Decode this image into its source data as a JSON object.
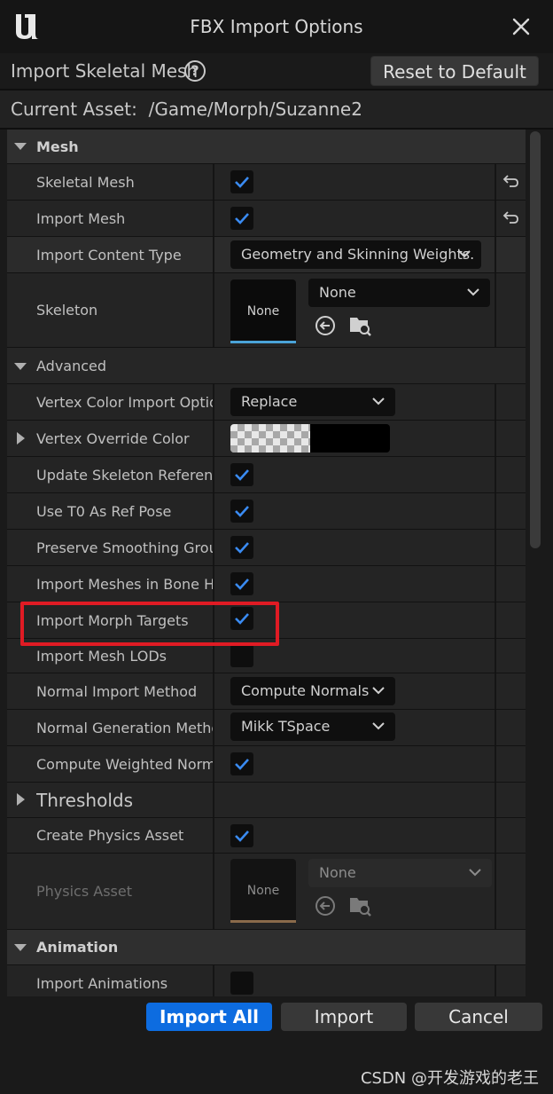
{
  "window": {
    "title": "FBX Import Options",
    "close_icon": "close-icon",
    "logo_icon": "unreal-logo-icon"
  },
  "header": {
    "label": "Import Skeletal Mesh",
    "help_icon": "?",
    "reset_label": "Reset to Default"
  },
  "asset": {
    "label": "Current Asset:  /Game/Morph/Suzanne2"
  },
  "sections": {
    "mesh": "Mesh",
    "advanced": "Advanced",
    "thresholds": "Thresholds",
    "animation": "Animation"
  },
  "rows": {
    "skeletal_mesh": "Skeletal Mesh",
    "import_mesh": "Import Mesh",
    "import_content_type": "Import Content Type",
    "import_content_type_value": "Geometry and Skinning Weights.",
    "skeleton": "Skeleton",
    "skeleton_value": "None",
    "skeleton_thumb": "None",
    "vertex_color_import": "Vertex Color Import Option",
    "vertex_color_import_value": "Replace",
    "vertex_override_color": "Vertex Override Color",
    "update_skeleton_ref": "Update Skeleton Referenc...",
    "use_t0": "Use T0 As Ref Pose",
    "preserve_smoothing": "Preserve Smoothing Groups",
    "import_bone_hierarchy": "Import Meshes in Bone Hi...",
    "import_morph_targets": "Import Morph Targets",
    "import_mesh_lods": "Import Mesh LODs",
    "normal_import_method": "Normal Import Method",
    "normal_import_method_value": "Compute Normals",
    "normal_generation_method": "Normal Generation Method",
    "normal_generation_method_value": "Mikk TSpace",
    "compute_weighted_normals": "Compute Weighted Normals",
    "create_physics_asset": "Create Physics Asset",
    "physics_asset": "Physics Asset",
    "physics_asset_value": "None",
    "physics_asset_thumb": "None",
    "import_animations": "Import Animations"
  },
  "checkboxes": {
    "skeletal_mesh": true,
    "import_mesh": true,
    "update_skeleton_ref": true,
    "use_t0": true,
    "preserve_smoothing": true,
    "import_bone_hierarchy": true,
    "import_morph_targets": true,
    "import_mesh_lods": false,
    "compute_weighted_normals": true,
    "create_physics_asset": true,
    "import_animations": false
  },
  "colors": {
    "accent": "#0d6ce0",
    "highlight_box": "#e01b24",
    "checkmark": "#3a8bf2"
  },
  "footer": {
    "import_all": "Import All",
    "import": "Import",
    "cancel": "Cancel"
  },
  "watermark": "CSDN @开发游戏的老王"
}
